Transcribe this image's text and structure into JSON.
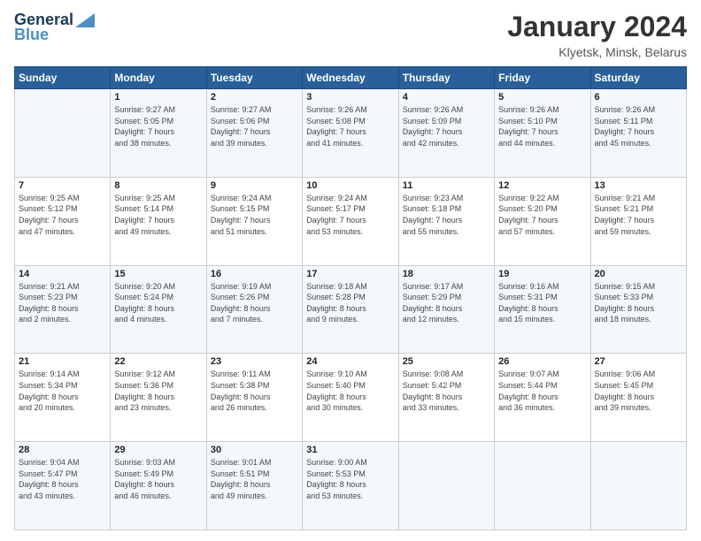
{
  "header": {
    "logo_line1": "General",
    "logo_line2": "Blue",
    "title": "January 2024",
    "subtitle": "Klyetsk, Minsk, Belarus"
  },
  "days_of_week": [
    "Sunday",
    "Monday",
    "Tuesday",
    "Wednesday",
    "Thursday",
    "Friday",
    "Saturday"
  ],
  "weeks": [
    [
      {
        "day": "",
        "info": ""
      },
      {
        "day": "1",
        "info": "Sunrise: 9:27 AM\nSunset: 5:05 PM\nDaylight: 7 hours\nand 38 minutes."
      },
      {
        "day": "2",
        "info": "Sunrise: 9:27 AM\nSunset: 5:06 PM\nDaylight: 7 hours\nand 39 minutes."
      },
      {
        "day": "3",
        "info": "Sunrise: 9:26 AM\nSunset: 5:08 PM\nDaylight: 7 hours\nand 41 minutes."
      },
      {
        "day": "4",
        "info": "Sunrise: 9:26 AM\nSunset: 5:09 PM\nDaylight: 7 hours\nand 42 minutes."
      },
      {
        "day": "5",
        "info": "Sunrise: 9:26 AM\nSunset: 5:10 PM\nDaylight: 7 hours\nand 44 minutes."
      },
      {
        "day": "6",
        "info": "Sunrise: 9:26 AM\nSunset: 5:11 PM\nDaylight: 7 hours\nand 45 minutes."
      }
    ],
    [
      {
        "day": "7",
        "info": "Sunrise: 9:25 AM\nSunset: 5:12 PM\nDaylight: 7 hours\nand 47 minutes."
      },
      {
        "day": "8",
        "info": "Sunrise: 9:25 AM\nSunset: 5:14 PM\nDaylight: 7 hours\nand 49 minutes."
      },
      {
        "day": "9",
        "info": "Sunrise: 9:24 AM\nSunset: 5:15 PM\nDaylight: 7 hours\nand 51 minutes."
      },
      {
        "day": "10",
        "info": "Sunrise: 9:24 AM\nSunset: 5:17 PM\nDaylight: 7 hours\nand 53 minutes."
      },
      {
        "day": "11",
        "info": "Sunrise: 9:23 AM\nSunset: 5:18 PM\nDaylight: 7 hours\nand 55 minutes."
      },
      {
        "day": "12",
        "info": "Sunrise: 9:22 AM\nSunset: 5:20 PM\nDaylight: 7 hours\nand 57 minutes."
      },
      {
        "day": "13",
        "info": "Sunrise: 9:21 AM\nSunset: 5:21 PM\nDaylight: 7 hours\nand 59 minutes."
      }
    ],
    [
      {
        "day": "14",
        "info": "Sunrise: 9:21 AM\nSunset: 5:23 PM\nDaylight: 8 hours\nand 2 minutes."
      },
      {
        "day": "15",
        "info": "Sunrise: 9:20 AM\nSunset: 5:24 PM\nDaylight: 8 hours\nand 4 minutes."
      },
      {
        "day": "16",
        "info": "Sunrise: 9:19 AM\nSunset: 5:26 PM\nDaylight: 8 hours\nand 7 minutes."
      },
      {
        "day": "17",
        "info": "Sunrise: 9:18 AM\nSunset: 5:28 PM\nDaylight: 8 hours\nand 9 minutes."
      },
      {
        "day": "18",
        "info": "Sunrise: 9:17 AM\nSunset: 5:29 PM\nDaylight: 8 hours\nand 12 minutes."
      },
      {
        "day": "19",
        "info": "Sunrise: 9:16 AM\nSunset: 5:31 PM\nDaylight: 8 hours\nand 15 minutes."
      },
      {
        "day": "20",
        "info": "Sunrise: 9:15 AM\nSunset: 5:33 PM\nDaylight: 8 hours\nand 18 minutes."
      }
    ],
    [
      {
        "day": "21",
        "info": "Sunrise: 9:14 AM\nSunset: 5:34 PM\nDaylight: 8 hours\nand 20 minutes."
      },
      {
        "day": "22",
        "info": "Sunrise: 9:12 AM\nSunset: 5:36 PM\nDaylight: 8 hours\nand 23 minutes."
      },
      {
        "day": "23",
        "info": "Sunrise: 9:11 AM\nSunset: 5:38 PM\nDaylight: 8 hours\nand 26 minutes."
      },
      {
        "day": "24",
        "info": "Sunrise: 9:10 AM\nSunset: 5:40 PM\nDaylight: 8 hours\nand 30 minutes."
      },
      {
        "day": "25",
        "info": "Sunrise: 9:08 AM\nSunset: 5:42 PM\nDaylight: 8 hours\nand 33 minutes."
      },
      {
        "day": "26",
        "info": "Sunrise: 9:07 AM\nSunset: 5:44 PM\nDaylight: 8 hours\nand 36 minutes."
      },
      {
        "day": "27",
        "info": "Sunrise: 9:06 AM\nSunset: 5:45 PM\nDaylight: 8 hours\nand 39 minutes."
      }
    ],
    [
      {
        "day": "28",
        "info": "Sunrise: 9:04 AM\nSunset: 5:47 PM\nDaylight: 8 hours\nand 43 minutes."
      },
      {
        "day": "29",
        "info": "Sunrise: 9:03 AM\nSunset: 5:49 PM\nDaylight: 8 hours\nand 46 minutes."
      },
      {
        "day": "30",
        "info": "Sunrise: 9:01 AM\nSunset: 5:51 PM\nDaylight: 8 hours\nand 49 minutes."
      },
      {
        "day": "31",
        "info": "Sunrise: 9:00 AM\nSunset: 5:53 PM\nDaylight: 8 hours\nand 53 minutes."
      },
      {
        "day": "",
        "info": ""
      },
      {
        "day": "",
        "info": ""
      },
      {
        "day": "",
        "info": ""
      }
    ]
  ]
}
